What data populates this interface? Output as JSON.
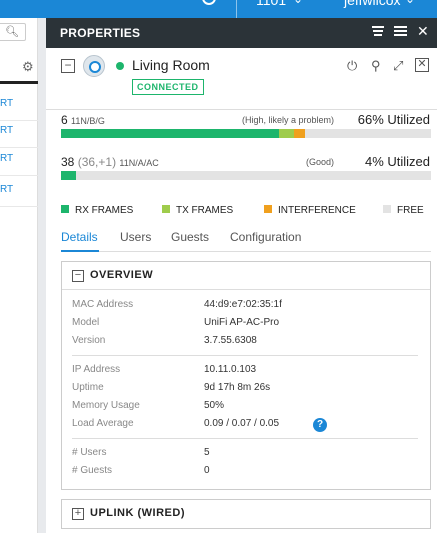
{
  "topbar": {
    "site": "1101",
    "user": "jeffwilcox"
  },
  "left": {
    "search_icon": "search-icon",
    "rows": [
      "RT",
      "RT",
      "RT",
      "RT"
    ]
  },
  "panel": {
    "title": "PROPERTIES"
  },
  "device": {
    "name": "Living Room",
    "status": "CONNECTED",
    "status_color": "#1db56c"
  },
  "radios": [
    {
      "channel": "6",
      "band": "11N/B/G",
      "sub": "",
      "note": "(High, likely a problem)",
      "utilization": "66% Utilized",
      "rx_pct": 59,
      "tx_pct": 4,
      "interference_pct": 3
    },
    {
      "channel": "38",
      "band": "11N/A/AC",
      "sub": "(36,+1)",
      "note": "(Good)",
      "utilization": "4% Utilized",
      "rx_pct": 4,
      "tx_pct": 0,
      "interference_pct": 0
    }
  ],
  "legend": [
    {
      "label": "RX FRAMES",
      "color": "#1db56c"
    },
    {
      "label": "TX FRAMES",
      "color": "#9fcc4c"
    },
    {
      "label": "INTERFERENCE",
      "color": "#f0a01e"
    },
    {
      "label": "FREE",
      "color": "#e3e3e3"
    }
  ],
  "tabs": [
    "Details",
    "Users",
    "Guests",
    "Configuration"
  ],
  "overview": {
    "title": "OVERVIEW",
    "group1": [
      {
        "key": "MAC Address",
        "value": "44:d9:e7:02:35:1f"
      },
      {
        "key": "Model",
        "value": "UniFi AP-AC-Pro"
      },
      {
        "key": "Version",
        "value": "3.7.55.6308"
      }
    ],
    "group2": [
      {
        "key": "IP Address",
        "value": "10.11.0.103"
      },
      {
        "key": "Uptime",
        "value": "9d 17h 8m 26s"
      },
      {
        "key": "Memory Usage",
        "value": "50%"
      },
      {
        "key": "Load Average",
        "value": "0.09 / 0.07 / 0.05"
      }
    ],
    "group3": [
      {
        "key": "# Users",
        "value": "5"
      },
      {
        "key": "# Guests",
        "value": "0"
      }
    ],
    "help_glyph": "?"
  },
  "uplink": {
    "title": "UPLINK (WIRED)"
  }
}
